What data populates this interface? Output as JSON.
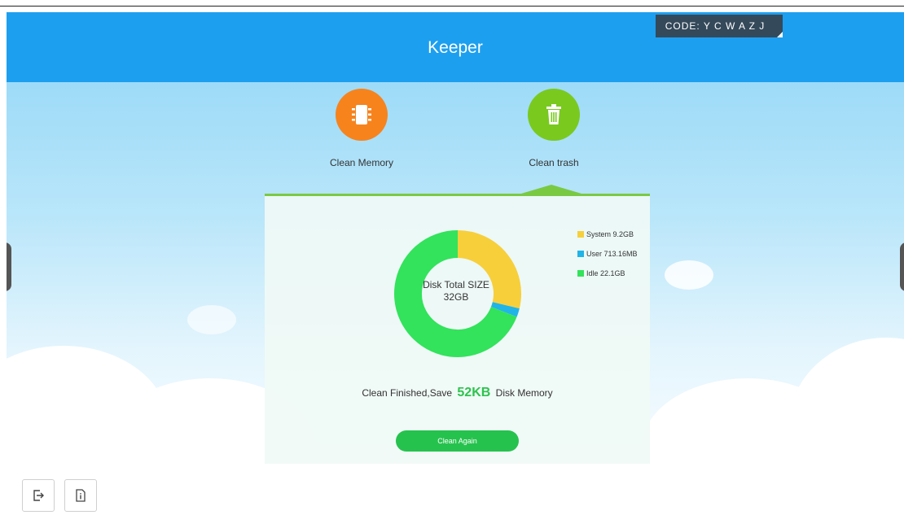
{
  "app": {
    "title": "Keeper",
    "code": "CODE: Y C W A Z J"
  },
  "features": [
    {
      "label": "Clean Memory",
      "icon": "memory-chip-icon",
      "color": "#f7831d"
    },
    {
      "label": "Clean trash",
      "icon": "trash-icon",
      "color": "#7ac91f"
    }
  ],
  "disk": {
    "center_title": "Disk Total SIZE",
    "center_value": "32GB",
    "legend": [
      {
        "label": "System 9.2GB",
        "color": "#f7cf3b"
      },
      {
        "label": "User 713.16MB",
        "color": "#21b4e7"
      },
      {
        "label": "Idle 22.1GB",
        "color": "#32e35b"
      }
    ]
  },
  "chart_data": {
    "type": "pie",
    "categories": [
      "System",
      "User",
      "Idle"
    ],
    "values": [
      9.2,
      0.713,
      22.1
    ],
    "units": [
      "GB",
      "MB",
      "GB"
    ],
    "display_values": [
      "9.2GB",
      "713.16MB",
      "22.1GB"
    ],
    "colors": [
      "#f7cf3b",
      "#21b4e7",
      "#32e35b"
    ],
    "donut": true,
    "legend": "right"
  },
  "result": {
    "prefix": "Clean Finished,Save",
    "amount": "52KB",
    "suffix": "Disk Memory"
  },
  "actions": {
    "clean_again": "Clean Again"
  },
  "bottom_buttons": [
    {
      "icon": "exit-icon"
    },
    {
      "icon": "info-icon"
    }
  ]
}
